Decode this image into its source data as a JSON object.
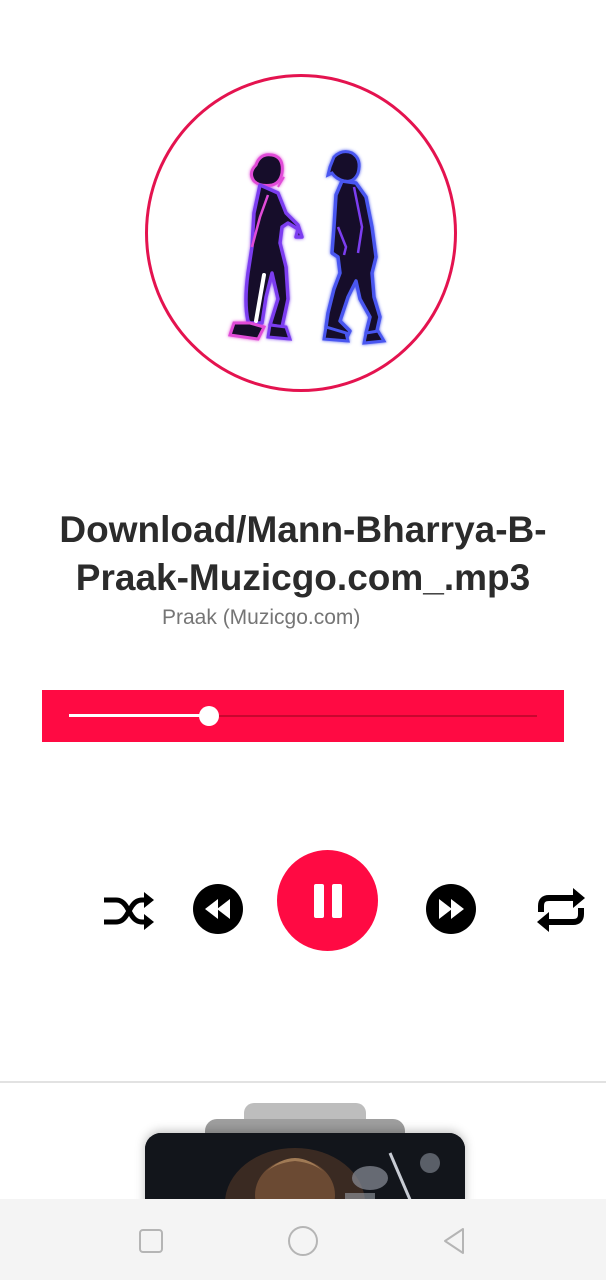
{
  "player": {
    "title": "Download/Mann-Bharrya-B-Praak-Muzicgo.com_.mp3",
    "title_line1": "Download/Mann-Bharrya-B-",
    "title_line2": "Praak-Muzicgo.com_.mp3",
    "artist": "Praak (Muzicgo.com)",
    "progress_fraction": 0.3,
    "state": "playing"
  },
  "controls": {
    "shuffle_icon": "shuffle-icon",
    "previous_icon": "rewind-icon",
    "play_pause_icon": "pause-icon",
    "next_icon": "fast-forward-icon",
    "repeat_icon": "repeat-icon"
  },
  "navigation": {
    "recents_icon": "square-icon",
    "home_icon": "circle-icon",
    "back_icon": "triangle-back-icon"
  },
  "colors": {
    "accent": "#ff0a43",
    "album_ring": "#e4134f",
    "title_text": "#2b2b2b",
    "artist_text": "#757575",
    "icon": "#000000",
    "nav_bar": "#f4f4f4"
  }
}
